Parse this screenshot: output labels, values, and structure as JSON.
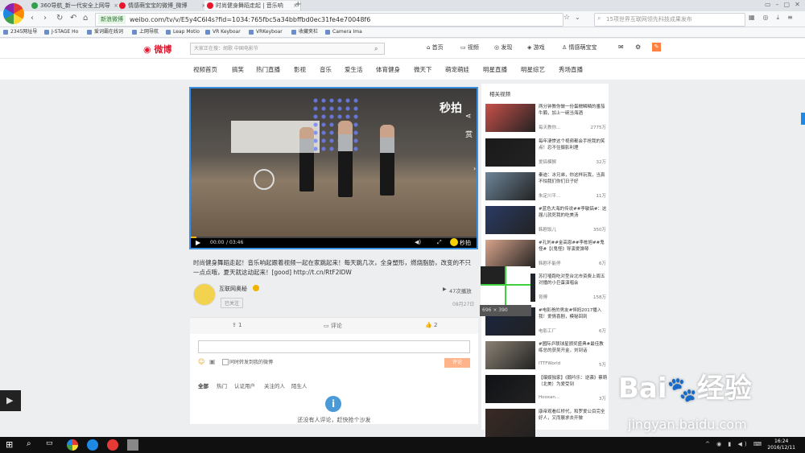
{
  "browser": {
    "tabs": [
      {
        "label": "360导航_新一代安全上网导"
      },
      {
        "label": "情感萌宝宝的微博_微博"
      },
      {
        "label": "时尚健身舞蹈走起 | 音乐响"
      }
    ],
    "secure_label": "新浪微博",
    "url": "weibo.com/tv/v/E5y4C6l4s?fid=1034:765fbc5a34bbffbd0ec31fe4e70048f6",
    "search_placeholder": "15项世界互联网领先科技成果发布",
    "bookmarks": [
      "2345网址导",
      "J-STAGE Ho",
      "爱词霸在线词",
      "上网导航",
      "Leap Motio",
      "VR Keyboar",
      "VRKeyboar",
      "收藏夹栏",
      "Camera Ima"
    ]
  },
  "weibo": {
    "logo": "微博",
    "search_placeholder": "大家正在搜：胡歌 中国电影节",
    "nav": [
      "首页",
      "视频",
      "发现",
      "游戏",
      "情感萌宝宝"
    ],
    "categories": [
      "视频首页",
      "搞笑",
      "热门直播",
      "影视",
      "音乐",
      "爱生活",
      "体育健身",
      "微天下",
      "萌宠萌娃",
      "明星直播",
      "明星综艺",
      "秀场直播"
    ]
  },
  "video": {
    "watermark": "秒拍",
    "time_current": "00:00",
    "time_total": "03:46",
    "progress": 0.02,
    "share_label": "赏",
    "miaopai_label": "秒拍"
  },
  "post": {
    "description": "时尚健身舞蹈走起！音乐响起跟着视频一起在家跳起来！每天跳几次，全身塑形，燃烧脂肪，改变的不只一点点哦，夏天就这动起来！[good] http://t.cn/RtF2IDW",
    "author": "互联网奥秘",
    "follow_label": "已关注",
    "play_count": "47次播放",
    "date": "08月27日"
  },
  "actions": {
    "repost": "1",
    "comment": "评论",
    "like": "2"
  },
  "comments": {
    "sync_label": "同时转发到我的微博",
    "submit_label": "评论",
    "filters": [
      "全部",
      "热门",
      "认证用户",
      "关注的人",
      "陌生人"
    ],
    "empty_text": "还没有人评论，赶快抢个沙发"
  },
  "sidebar": {
    "title": "相关视频",
    "items": [
      {
        "title": "两分钟教你做一份蛋糯鳞鳞的番茄牛腩，加上一碗当海酒",
        "author": "每天教你...",
        "count": "2775万",
        "color": "#c8504a"
      },
      {
        "title": "每年凄惨这个视频都会手抢我的笑点！忍不住摄影利理",
        "author": "爱搞模猴",
        "count": "32万",
        "color": "#1a1a1a"
      },
      {
        "title": "秦迪：冰兄弟，你这样玩我，当真不怕我们你们日子好",
        "author": "朱定川平...",
        "count": "11万",
        "color": "#6d8599"
      },
      {
        "title": "#蓝色大海的传说##李敏镐#：这届儿就死我的吃美汤",
        "author": "韩剧饭儿",
        "count": "350万",
        "color": "#2b3b66"
      },
      {
        "title": "#孔刘##金高恩##李栋旭##鬼怪#【《鬼怪》导演爱弹琴",
        "author": "韩剧不能停",
        "count": "6万",
        "color": "#d9a48b"
      },
      {
        "title": "苏打嗑跑吃对型台北市资费上周五对播的小巨蛋演唱会",
        "author": "育傅",
        "count": "158万",
        "color": "#1b2a40"
      },
      {
        "title": "#电影爸的男友#恒妈2017播入我！爱情喜剧，模秘回到",
        "author": "电影工厂",
        "count": "6万",
        "color": "#1a2540"
      },
      {
        "title": "#國际乒联球星颁奖盛典#最佳教练总的获吴开金，刘到话",
        "author": "ITTFWorld",
        "count": "5万",
        "color": "#8a8174"
      },
      {
        "title": "【爆娱独家】《鹅吟乐：逆袭》蔡萌（北美）为爱受到",
        "author": "Hooxan...",
        "count": "3万",
        "color": "#101216"
      },
      {
        "title": "康帝观看红桥代，和罗爱公目完全好人，又而展求去开做",
        "author": "",
        "count": "",
        "color": "#3a2a24"
      }
    ]
  },
  "overlay": {
    "dimension": "696 × 390"
  },
  "watermark": {
    "brand": "Bai",
    "suffix": "经验",
    "url": "jingyan.baidu.com"
  },
  "taskbar": {
    "time": "16:24",
    "date": "2016/12/11"
  }
}
